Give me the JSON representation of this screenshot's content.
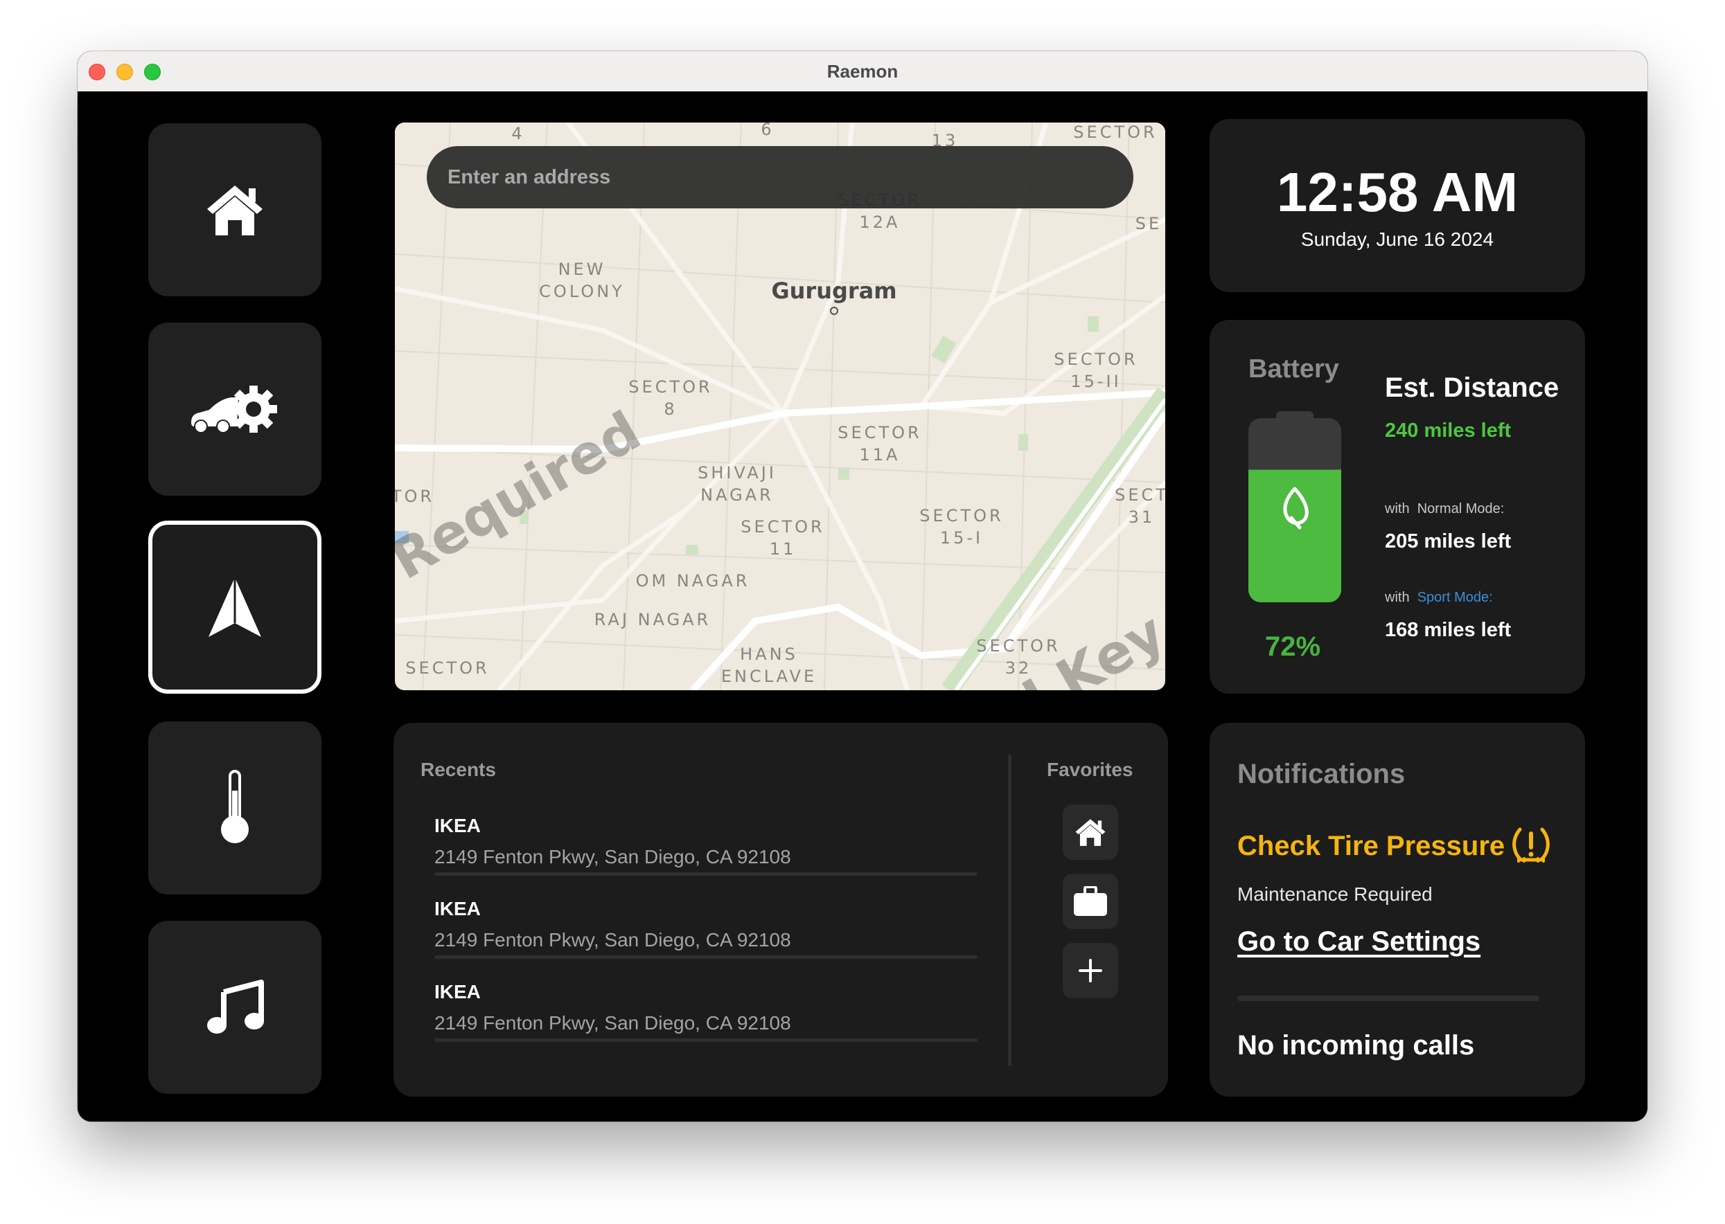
{
  "window": {
    "title": "Raemon"
  },
  "sidebar": {
    "items": [
      {
        "name": "home",
        "icon": "home-icon",
        "active": false
      },
      {
        "name": "car-settings",
        "icon": "car-gear-icon",
        "active": false
      },
      {
        "name": "navigation",
        "icon": "navigation-arrow-icon",
        "active": true
      },
      {
        "name": "climate",
        "icon": "thermometer-icon",
        "active": false
      },
      {
        "name": "music",
        "icon": "music-note-icon",
        "active": false
      }
    ]
  },
  "map": {
    "search_placeholder": "Enter an address",
    "city": "Gurugram",
    "labels": {
      "l4": "4",
      "l6": "6",
      "l13": "13",
      "sector_top_right": "SECTOR",
      "sector_12a": "SECTOR\n12A",
      "se": "SE",
      "new_colony": "NEW\nCOLONY",
      "sector_8": "SECTOR\n8",
      "sector_15_ii": "SECTOR\n15-II",
      "sector_11a": "SECTOR\n11A",
      "shivaji_nagar": "SHIVAJI\nNAGAR",
      "tor": "TOR",
      "sector_11": "SECTOR\n11",
      "sector_15_i": "SECTOR\n15-I",
      "sect_31": "SECT\n31",
      "om_nagar": "OM NAGAR",
      "raj_nagar": "RAJ NAGAR",
      "hans_enclave": "HANS\nENCLAVE",
      "sector_32": "SECTOR\n32",
      "sector_bottom_left": "SECTOR"
    },
    "watermark_left": "Required",
    "watermark_right": "API Key Req"
  },
  "clock": {
    "time": "12:58 AM",
    "date": "Sunday, June 16 2024"
  },
  "battery": {
    "label": "Battery",
    "percent_text": "72%",
    "level": 0.72,
    "fill_color": "#4cbb3f",
    "est_title": "Est. Distance",
    "est_main": "240 miles left",
    "with": "with",
    "normal_mode_label": "Normal Mode:",
    "normal_mode_value": "205 miles left",
    "sport_mode_label": "Sport Mode:",
    "sport_mode_value": "168 miles left"
  },
  "recents": {
    "title": "Recents",
    "items": [
      {
        "name": "IKEA",
        "address": "2149 Fenton Pkwy, San Diego, CA 92108"
      },
      {
        "name": "IKEA",
        "address": "2149 Fenton Pkwy, San Diego, CA 92108"
      },
      {
        "name": "IKEA",
        "address": "2149 Fenton Pkwy, San Diego, CA 92108"
      }
    ]
  },
  "favorites": {
    "title": "Favorites",
    "items": [
      {
        "icon": "home-icon"
      },
      {
        "icon": "briefcase-icon"
      },
      {
        "icon": "plus-icon"
      }
    ]
  },
  "notifications": {
    "title": "Notifications",
    "alert_title": "Check Tire Pressure",
    "alert_icon": "tire-pressure-warning-icon",
    "alert_color": "#f5b40f",
    "alert_subtitle": "Maintenance Required",
    "link_label": "Go to Car Settings",
    "calls_status": "No incoming calls"
  }
}
